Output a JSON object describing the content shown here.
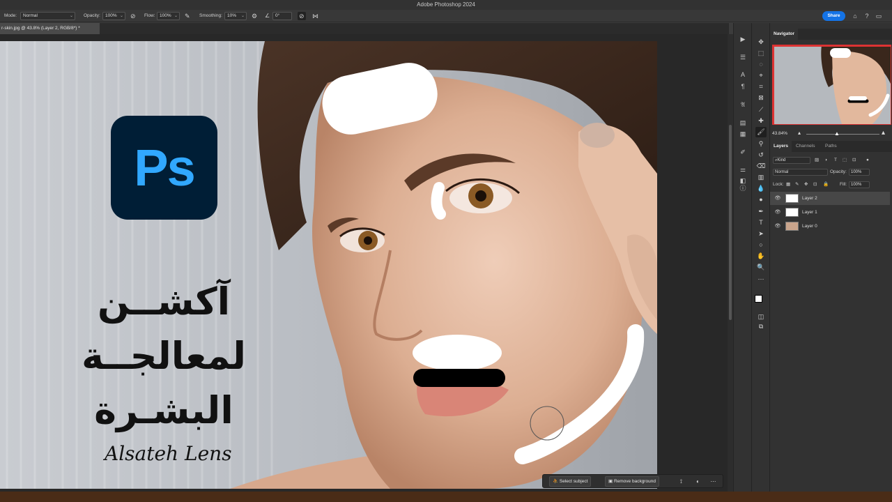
{
  "window": {
    "title": "Adobe Photoshop 2024"
  },
  "options_bar": {
    "mode_label": "Mode:",
    "mode_value": "Normal",
    "opacity_label": "Opacity:",
    "opacity_value": "100%",
    "flow_label": "Flow:",
    "flow_value": "100%",
    "smoothing_label": "Smoothing:",
    "smoothing_value": "10%",
    "angle_value": "0°",
    "share_label": "Share"
  },
  "document": {
    "tab_label": "r-skin.jpg @ 43.8% (Layer 2, RGB/8*) *"
  },
  "canvas": {
    "logo_text": "Ps",
    "arabic_line1": "آكشــن لمعالجــة",
    "arabic_line2": "البشـرة",
    "signature": "Alsateh Lens"
  },
  "contextual_bar": {
    "select_subject": "Select subject",
    "remove_background": "Remove background"
  },
  "navigator": {
    "tab_label": "Navigator",
    "zoom": "43.84%"
  },
  "layers_panel": {
    "tabs": [
      "Layers",
      "Channels",
      "Paths"
    ],
    "filter_label": "Kind",
    "blend_mode": "Normal",
    "opacity_label": "Opacity:",
    "opacity_value": "100%",
    "lock_label": "Lock:",
    "fill_label": "Fill:",
    "fill_value": "100%",
    "layers": [
      {
        "name": "Layer 2"
      },
      {
        "name": "Layer 1"
      },
      {
        "name": "Layer 0"
      }
    ]
  },
  "colors": {
    "accent": "#1473e6",
    "ps_logo_bg": "#001e36",
    "ps_logo_fg": "#31a8ff"
  }
}
